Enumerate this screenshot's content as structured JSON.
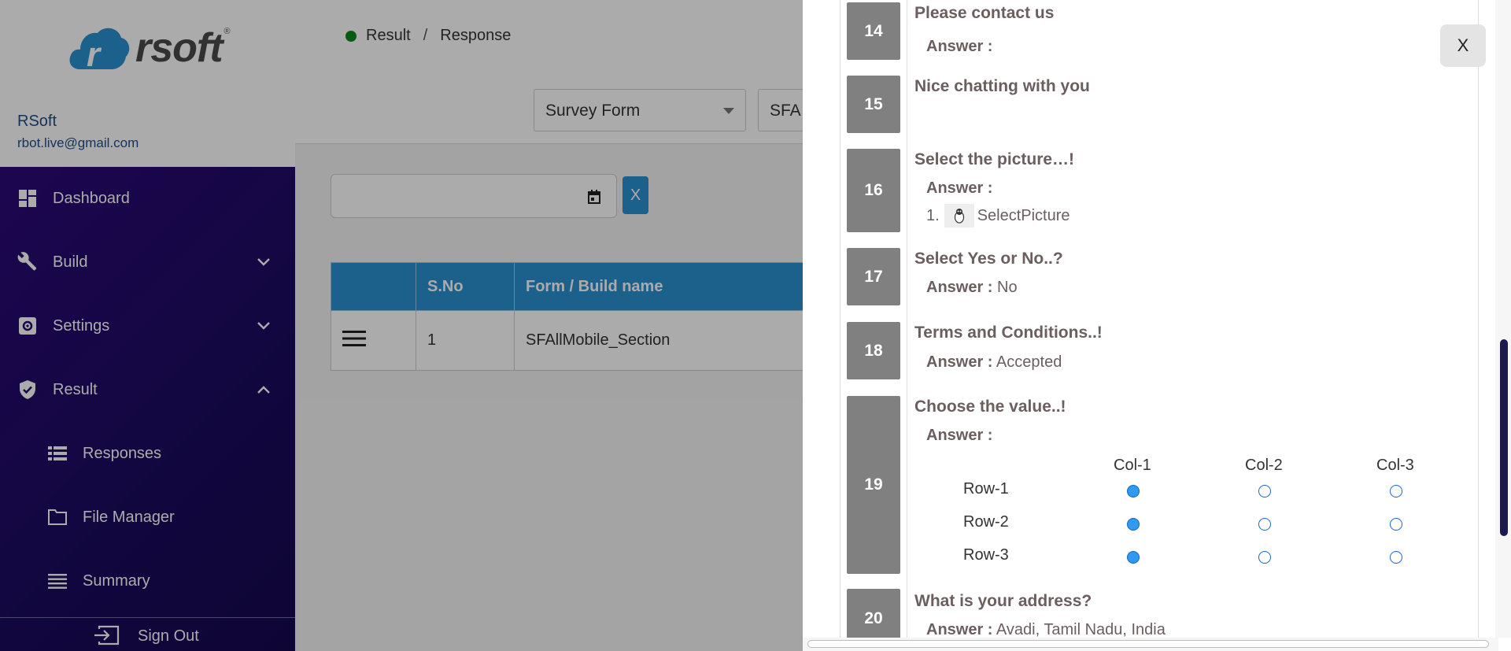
{
  "brand": {
    "name": "rsoft",
    "reg": "®"
  },
  "user": {
    "name": "RSoft",
    "email": "rbot.live@gmail.com"
  },
  "nav": {
    "dashboard": "Dashboard",
    "build": "Build",
    "settings": "Settings",
    "result": "Result",
    "responses": "Responses",
    "file_manager": "File Manager",
    "summary": "Summary",
    "sign_out": "Sign Out"
  },
  "breadcrumb": {
    "first": "Result",
    "sep": "/",
    "second": "Response"
  },
  "filters": {
    "form_type": "Survey Form",
    "form_name": "SFA",
    "clear_label": "X"
  },
  "table": {
    "headers": [
      "",
      "S.No",
      "Form / Build name"
    ],
    "rows": [
      {
        "sno": "1",
        "name": "SFAllMobile_Section"
      }
    ]
  },
  "modal": {
    "close_label": "X",
    "answer_label": "Answer :",
    "questions": [
      {
        "num": "14",
        "text": "Please contact us",
        "answer": ""
      },
      {
        "num": "15",
        "text": "Nice chatting with you"
      },
      {
        "num": "16",
        "text": "Select the picture…!",
        "answer": "",
        "pic_index": "1.",
        "pic_label": "SelectPicture"
      },
      {
        "num": "17",
        "text": "Select Yes or No..?",
        "answer": "No"
      },
      {
        "num": "18",
        "text": "Terms and Conditions..!",
        "answer": "Accepted"
      },
      {
        "num": "19",
        "text": "Choose the value..!",
        "answer": ""
      },
      {
        "num": "20",
        "text": "What is your address?",
        "answer": "Avadi, Tamil Nadu, India"
      }
    ],
    "grid": {
      "columns": [
        "Col-1",
        "Col-2",
        "Col-3"
      ],
      "rows": [
        "Row-1",
        "Row-2",
        "Row-3"
      ],
      "selected": [
        0,
        0,
        0
      ]
    }
  }
}
